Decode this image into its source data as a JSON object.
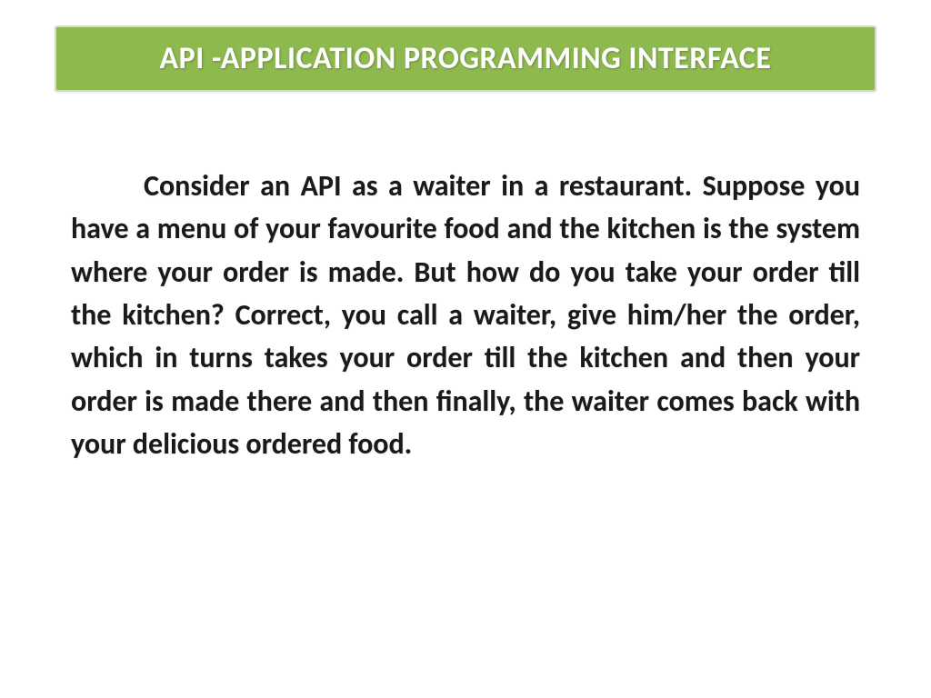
{
  "slide": {
    "title": "API  -APPLICATION PROGRAMMING INTERFACE",
    "body": "Consider an API as a waiter in a restaurant. Suppose you have a menu of your favourite food and the kitchen is the system where your order is made. But how do you take your order till the kitchen? Correct, you call a waiter, give him/her the order, which in turns takes your order till the kitchen and then your order is made there and then finally, the waiter comes back with your delicious ordered food."
  }
}
